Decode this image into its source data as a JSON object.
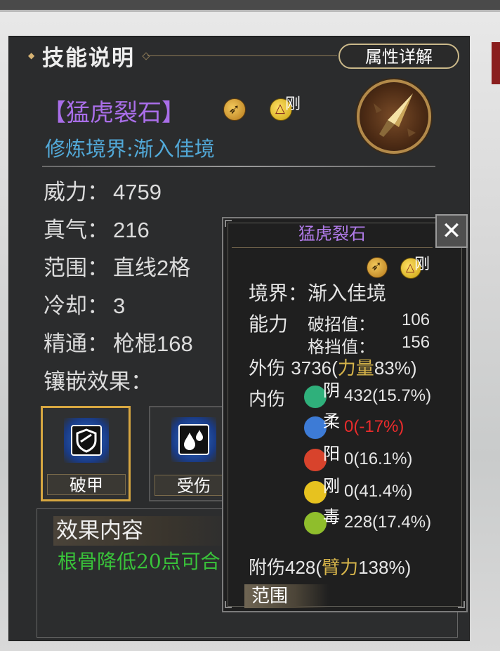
{
  "header": {
    "title": "技能说明",
    "detail_button": "属性详解"
  },
  "skill": {
    "name": "【猛虎裂石】",
    "badge_text": "刚",
    "realm": "修炼境界:渐入佳境",
    "icon": "spear-tip-icon"
  },
  "stats": [
    {
      "label": "威力：",
      "value": "4759"
    },
    {
      "label": "真气：",
      "value": "216"
    },
    {
      "label": "范围：",
      "value": "直线2格"
    },
    {
      "label": "冷却：",
      "value": "3"
    },
    {
      "label": "精通：",
      "value": "枪棍168"
    }
  ],
  "inlay": {
    "title": "镶嵌效果：",
    "slots": [
      {
        "label": "破甲",
        "icon": "shield-icon",
        "selected": true
      },
      {
        "label": "受伤",
        "icon": "blood-drops-icon",
        "selected": false
      }
    ]
  },
  "effect": {
    "title": "效果内容",
    "text": "根骨降低20点可合"
  },
  "popup": {
    "title": "猛虎裂石",
    "badge_text": "刚",
    "realm_label": "境界：",
    "realm_value": "渐入佳境",
    "ability_label": "能力",
    "break_label": "破招值：",
    "break_value": "106",
    "block_label": "格挡值：",
    "block_value": "156",
    "outer_label": "外伤",
    "outer_value": "3736",
    "outer_paren_open": "(",
    "outer_attr": "力量",
    "outer_pct": "83%)",
    "inner_label": "内伤",
    "inner_rows": [
      {
        "element": "阴",
        "value": "432",
        "pct": "(15.7%)",
        "color": "#2fb07b",
        "negative": false
      },
      {
        "element": "柔",
        "value": "0",
        "pct": "(-17%)",
        "color": "#3d7bd6",
        "negative": true
      },
      {
        "element": "阳",
        "value": "0",
        "pct": "(16.1%)",
        "color": "#d8432c",
        "negative": false
      },
      {
        "element": "刚",
        "value": "0",
        "pct": "(41.4%)",
        "color": "#e7c21f",
        "negative": false
      },
      {
        "element": "毒",
        "value": "228",
        "pct": "(17.4%)",
        "color": "#8fbe2c",
        "negative": false
      }
    ],
    "extra_label": "附伤",
    "extra_value": "428",
    "extra_paren_open": "(",
    "extra_attr": "臂力",
    "extra_pct": "138%)",
    "range_tab": "范围",
    "close_icon": "close-icon"
  }
}
